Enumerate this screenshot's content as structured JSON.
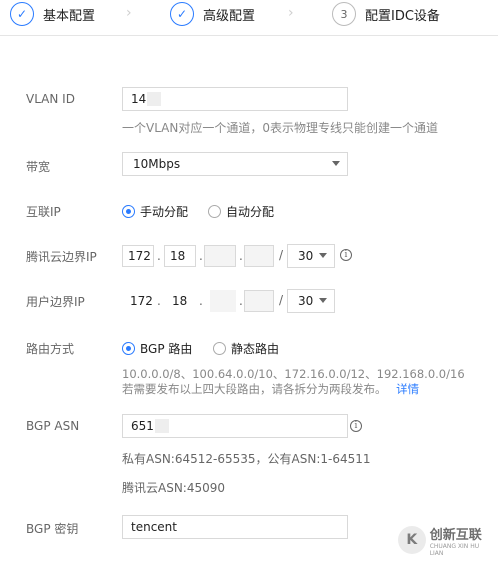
{
  "steps": [
    {
      "label": "基本配置",
      "status": "done",
      "marker": "✓"
    },
    {
      "label": "高级配置",
      "status": "done",
      "marker": "✓"
    },
    {
      "label": "配置IDC设备",
      "status": "todo",
      "marker": "3"
    }
  ],
  "form": {
    "vlan": {
      "label": "VLAN ID",
      "value": "14",
      "hint": "一个VLAN对应一个通道，0表示物理专线只能创建一个通道"
    },
    "bandwidth": {
      "label": "带宽",
      "value": "10Mbps"
    },
    "interconnect_ip": {
      "label": "互联IP",
      "options": [
        "手动分配",
        "自动分配"
      ],
      "selected": "手动分配"
    },
    "tencent_border_ip": {
      "label": "腾讯云边界IP",
      "octets": [
        "172",
        "18",
        "",
        ""
      ],
      "mask": "30"
    },
    "user_border_ip": {
      "label": "用户边界IP",
      "octets": [
        "172",
        "18",
        "",
        ""
      ],
      "mask": "30"
    },
    "routing": {
      "label": "路由方式",
      "options": [
        "BGP 路由",
        "静态路由"
      ],
      "selected": "BGP 路由",
      "hint_line1": "10.0.0.0/8、100.64.0.0/10、172.16.0.0/12、192.168.0.0/16",
      "hint_line2": "若需要发布以上四大段路由，请各拆分为两段发布。",
      "hint_link": "详情"
    },
    "bgp_asn": {
      "label": "BGP ASN",
      "value": "651",
      "hint_line1": "私有ASN:64512-65535，公有ASN:1-64511",
      "hint_line2": "腾讯云ASN:45090"
    },
    "bgp_key": {
      "label": "BGP 密钥",
      "value": "tencent"
    }
  },
  "watermark": {
    "title": "创新互联",
    "subtitle": "CHUANG XIN HU LIAN",
    "logo": "K"
  }
}
